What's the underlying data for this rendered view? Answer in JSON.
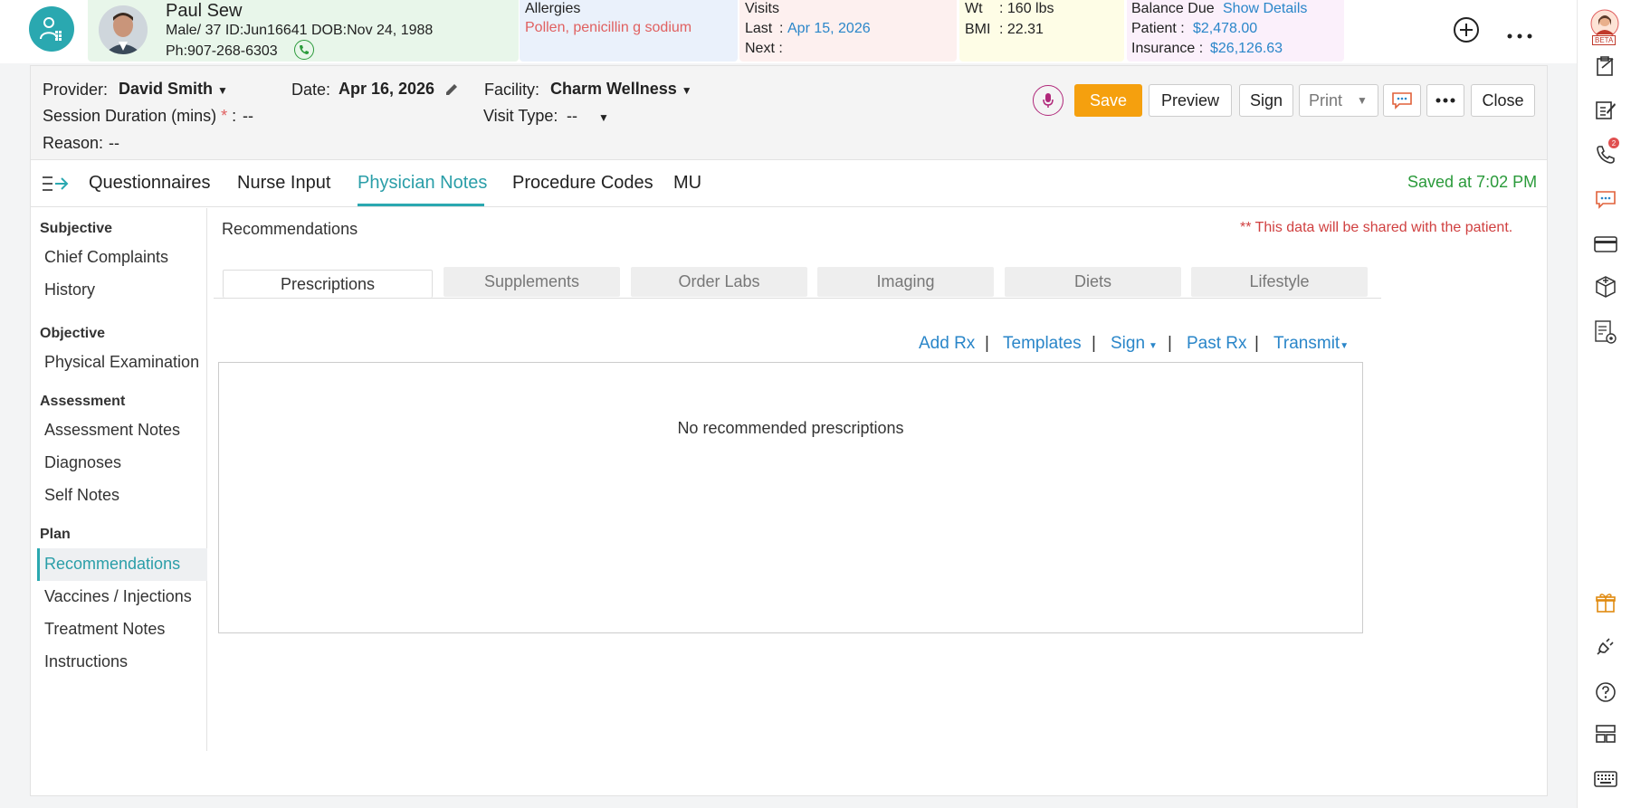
{
  "patient": {
    "name": "Paul Sew",
    "demographics": "Male/ 37  ID:Jun16641  DOB:Nov 24, 1988",
    "phone": "Ph:907-268-6303"
  },
  "allergies": {
    "label": "Allergies",
    "value": "Pollen, penicillin g sodium"
  },
  "visits": {
    "label": "Visits",
    "last_label": "Last",
    "last_value": "Apr 15, 2026",
    "next_label": "Next :"
  },
  "vitals": {
    "wt_label": "Wt",
    "wt_value": ": 160 lbs",
    "bmi_label": "BMI",
    "bmi_value": ": 22.31"
  },
  "balance": {
    "label": "Balance Due",
    "show_details": "Show Details",
    "patient_label": "Patient :",
    "patient_value": "$2,478.00",
    "insurance_label": "Insurance :",
    "insurance_value": "$26,126.63"
  },
  "encounter": {
    "provider_label": "Provider:",
    "provider_value": "David Smith",
    "date_label": "Date:",
    "date_value": "Apr 16, 2026",
    "facility_label": "Facility:",
    "facility_value": "Charm Wellness",
    "session_label": "Session Duration (mins)",
    "session_req": "*",
    "session_colon": ":",
    "session_value": "--",
    "visit_type_label": "Visit Type:",
    "visit_type_value": "--",
    "reason_label": "Reason:",
    "reason_value": "--"
  },
  "buttons": {
    "save": "Save",
    "preview": "Preview",
    "sign": "Sign",
    "print": "Print",
    "close": "Close"
  },
  "main_tabs": [
    "Questionnaires",
    "Nurse Input",
    "Physician Notes",
    "Procedure Codes",
    "MU"
  ],
  "saved_status": "Saved at 7:02 PM",
  "left_nav": {
    "subjective": "Subjective",
    "chief_complaints": "Chief Complaints",
    "history": "History",
    "objective": "Objective",
    "physical_exam": "Physical Examination",
    "assessment": "Assessment",
    "assessment_notes": "Assessment Notes",
    "diagnoses": "Diagnoses",
    "self_notes": "Self Notes",
    "plan": "Plan",
    "recommendations": "Recommendations",
    "vaccines": "Vaccines / Injections",
    "treatment_notes": "Treatment Notes",
    "instructions": "Instructions"
  },
  "content": {
    "title": "Recommendations",
    "share_notice": "** This data will be shared with the patient.",
    "sub_tabs": [
      "Prescriptions",
      "Supplements",
      "Order Labs",
      "Imaging",
      "Diets",
      "Lifestyle"
    ],
    "actions": {
      "add_rx": "Add Rx",
      "templates": "Templates",
      "sign": "Sign",
      "past_rx": "Past Rx",
      "transmit": "Transmit",
      "sep": "|"
    },
    "empty_message": "No recommended prescriptions"
  },
  "right_bar": {
    "beta": "BETA",
    "call_badge": "2"
  },
  "colors": {
    "accent": "#2aa8b0",
    "save": "#f5a00e",
    "link": "#2a86c9",
    "alert": "#e06060",
    "success": "#2a9a3a"
  }
}
